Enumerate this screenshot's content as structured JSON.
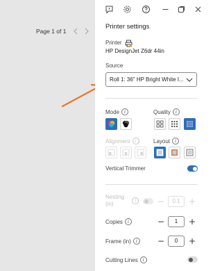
{
  "preview": {
    "page_indicator": "Page 1 of 1"
  },
  "panel": {
    "title": "Printer settings",
    "printer_label": "Printer",
    "printer_name": "HP DesignJet Z6dr 44in",
    "source_label": "Source",
    "source_value": "Roll 1: 36\" HP Bright White I...",
    "mode_label": "Mode",
    "quality_label": "Quality",
    "alignment_label": "Alignment",
    "layout_label": "Layout",
    "vertical_trimmer_label": "Vertical Trimmer",
    "vertical_trimmer_on": true,
    "nesting_label_line1": "Nesting",
    "nesting_label_line2": "(in)",
    "nesting_value": "0.1",
    "copies_label": "Copies",
    "copies_value": "1",
    "frame_label": "Frame (in)",
    "frame_value": "0",
    "cutting_lines_label": "Cutting Lines",
    "cutting_lines_on": false,
    "minus_symbol": "−",
    "plus_symbol": "+",
    "info_symbol": "i"
  },
  "colors": {
    "accent": "#2f6db5",
    "arrow": "#e8762c",
    "preview_bg": "#e6e6e6"
  },
  "icons": {
    "top_bar": [
      "feedback-icon",
      "settings-gear-icon",
      "help-icon",
      "minimize-icon",
      "restore-icon",
      "close-icon"
    ],
    "mode_options": [
      "color-mode-icon",
      "grayscale-mode-icon"
    ],
    "quality_options": [
      "quality-speed-icon",
      "quality-normal-icon",
      "quality-best-icon"
    ],
    "alignment_options": [
      "align-left-icon",
      "align-center-icon",
      "align-right-icon"
    ],
    "layout_options": [
      "layout-no-margins-icon",
      "layout-with-margins-icon",
      "layout-oversize-icon"
    ]
  }
}
